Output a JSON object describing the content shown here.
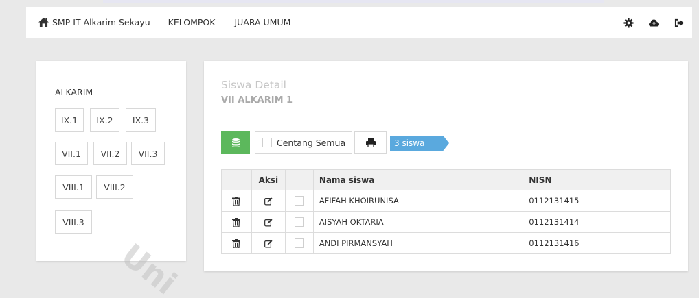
{
  "navbar": {
    "brand": "SMP IT Alkarim Sekayu",
    "links": [
      "KELOMPOK",
      "JUARA UMUM"
    ],
    "icons": [
      "gear-icon",
      "cloud-upload-icon",
      "logout-icon"
    ]
  },
  "sidebar": {
    "group_title": "ALKARIM",
    "classes": [
      "IX.1",
      "IX.2",
      "IX.3",
      "VII.1",
      "VII.2",
      "VII.3",
      "VIII.1",
      "VIII.2",
      "VIII.3"
    ]
  },
  "detail": {
    "title": "Siswa Detail",
    "subtitle": "VII ALKARIM 1",
    "check_all_label": "Centang Semua",
    "count_label": "3 siswa",
    "colors": {
      "success": "#5cb85c",
      "info": "#5aa9de"
    }
  },
  "table": {
    "headers": {
      "aksi": "Aksi",
      "nama": "Nama siswa",
      "nisn": "NISN"
    },
    "rows": [
      {
        "nama": "AFIFAH KHOIRUNISA",
        "nisn": "0112131415"
      },
      {
        "nama": "AISYAH OKTARIA",
        "nisn": "0112131414"
      },
      {
        "nama": "ANDI PIRMANSYAH",
        "nisn": "0112131416"
      }
    ]
  },
  "watermark": "Uni"
}
